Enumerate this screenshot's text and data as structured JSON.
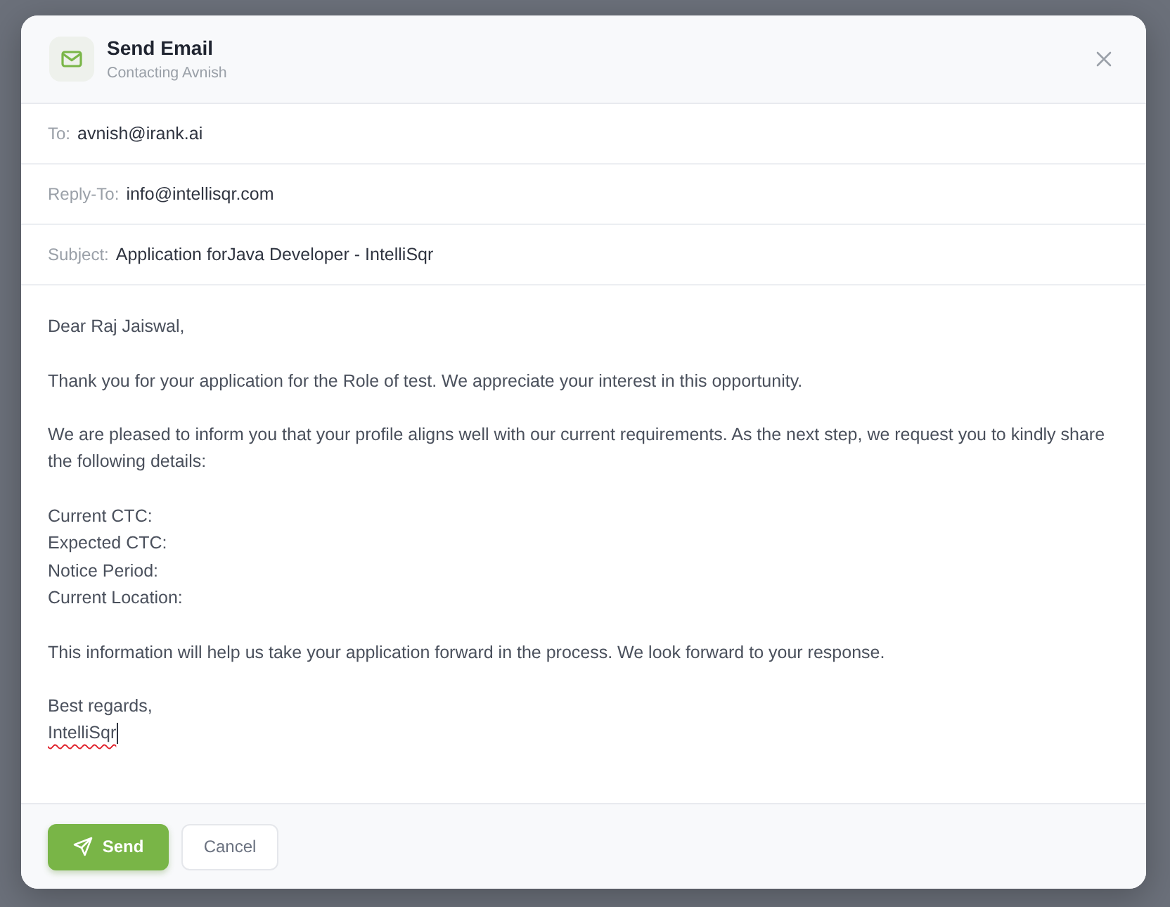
{
  "dialog": {
    "title": "Send Email",
    "subtitle": "Contacting Avnish"
  },
  "fields": [
    {
      "label": "To:",
      "value": "avnish@irank.ai"
    },
    {
      "label": "Reply-To:",
      "value": "info@intellisqr.com"
    },
    {
      "label": "Subject:",
      "value": "Application forJava Developer - IntelliSqr"
    }
  ],
  "message": {
    "paragraphs": [
      [
        "Dear Raj Jaiswal,"
      ],
      [
        "Thank you for your application for the Role of test. We appreciate your interest in this opportunity."
      ],
      [
        "We are pleased to inform you that your profile aligns well with our current requirements. As the next step, we request you to kindly share",
        "the following details:"
      ],
      [
        "Current CTC:",
        "Expected CTC:",
        "Notice Period:",
        "Current Location:"
      ],
      [
        "This information will help us take your application forward in the process. We look forward to your response."
      ]
    ],
    "signature": {
      "closing": "Best regards,",
      "name": "IntelliSqr",
      "misspelled": true,
      "caret": true
    }
  },
  "buttons": [
    {
      "label": "Send",
      "kind": "primary"
    },
    {
      "label": "Cancel",
      "kind": "secondary"
    }
  ]
}
